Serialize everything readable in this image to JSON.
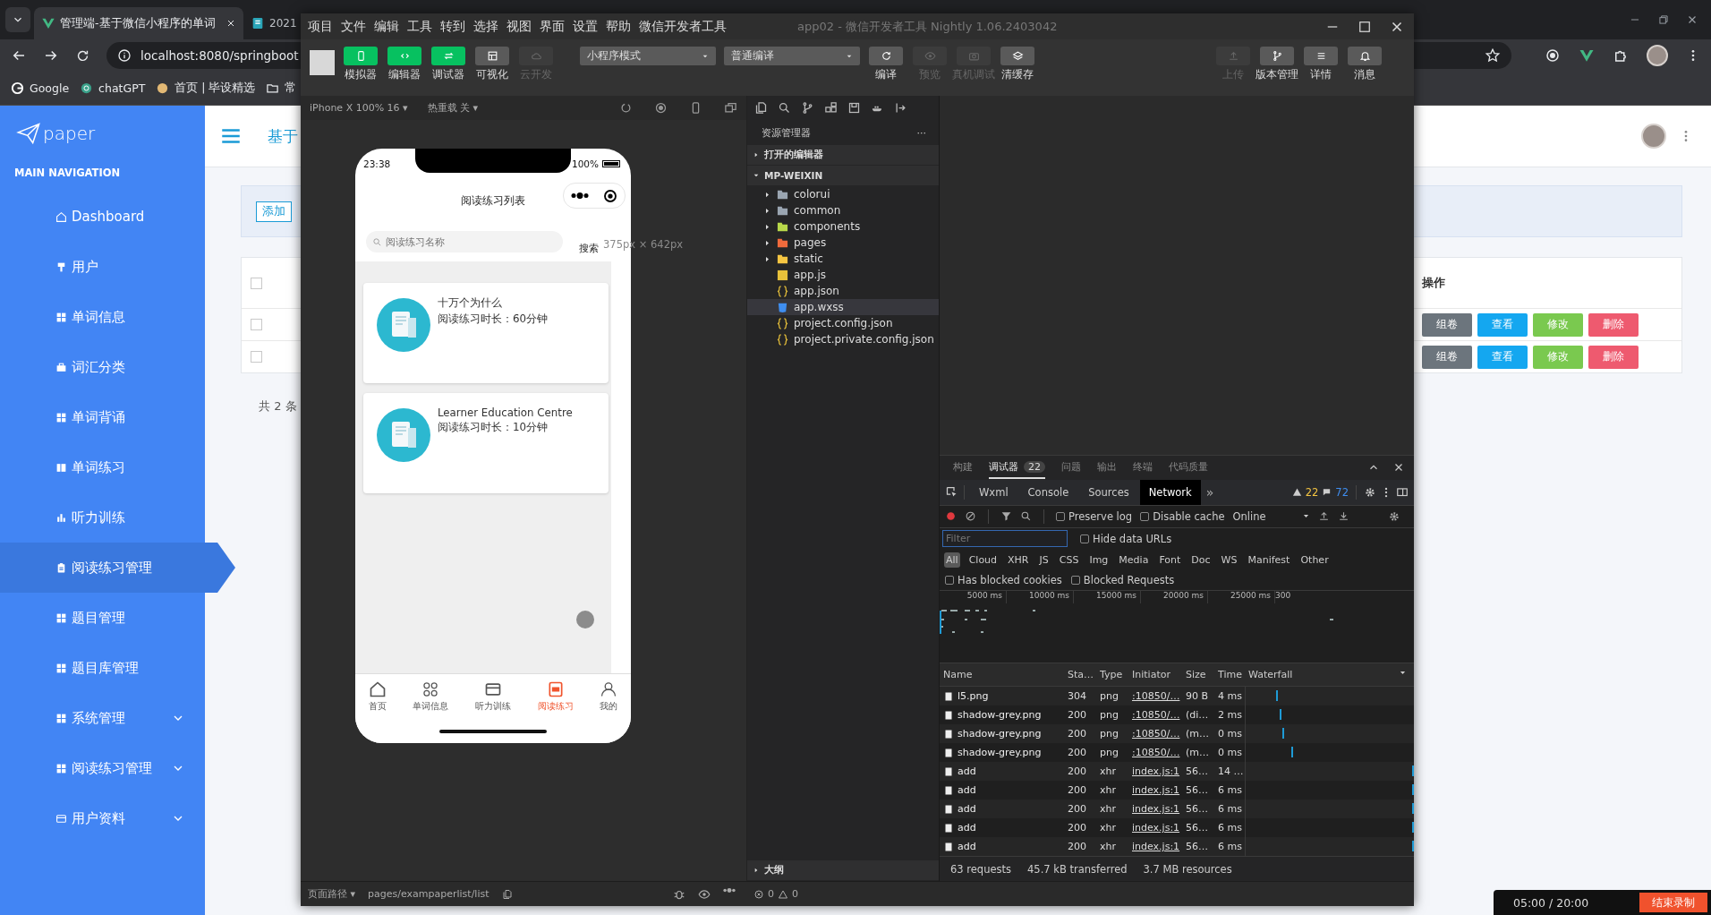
{
  "browser": {
    "tabs": [
      {
        "title": "管理端-基于微信小程序的单词",
        "selected": true
      },
      {
        "title": "2021",
        "selected": false
      }
    ],
    "address": "localhost:8080/springboot",
    "bookmarks": [
      {
        "label": "Google"
      },
      {
        "label": "chatGPT"
      },
      {
        "label": "首页 | 毕设精选"
      },
      {
        "label": "常"
      }
    ]
  },
  "admin": {
    "logo": "paper",
    "nav_heading": "MAIN NAVIGATION",
    "nav": [
      {
        "label": "Dashboard",
        "kind": "link",
        "selected": false
      },
      {
        "label": "用户",
        "kind": "link",
        "selected": false
      },
      {
        "label": "单词信息",
        "kind": "link",
        "selected": false
      },
      {
        "label": "词汇分类",
        "kind": "link",
        "selected": false
      },
      {
        "label": "单词背诵",
        "kind": "link",
        "selected": false
      },
      {
        "label": "单词练习",
        "kind": "link",
        "selected": false
      },
      {
        "label": "听力训练",
        "kind": "link",
        "selected": false
      },
      {
        "label": "阅读练习管理",
        "kind": "link",
        "selected": true
      },
      {
        "label": "题目管理",
        "kind": "link",
        "selected": false
      },
      {
        "label": "题目库管理",
        "kind": "link",
        "selected": false
      },
      {
        "label": "系统管理",
        "kind": "group",
        "selected": false
      },
      {
        "label": "阅读练习管理",
        "kind": "group",
        "selected": false
      },
      {
        "label": "用户资料",
        "kind": "group",
        "selected": false
      }
    ],
    "header_title": "基于",
    "add_button": "添加",
    "table": {
      "header_checked": false,
      "actions_header": "操作",
      "rows": [
        {
          "checked": false,
          "actions": [
            {
              "label": "组卷",
              "color": "#6c757d"
            },
            {
              "label": "查看",
              "color": "#14a7f0"
            },
            {
              "label": "修改",
              "color": "#7ac94f"
            },
            {
              "label": "删除",
              "color": "#ee5a6f"
            }
          ]
        },
        {
          "checked": false,
          "actions": [
            {
              "label": "组卷",
              "color": "#6c757d"
            },
            {
              "label": "查看",
              "color": "#14a7f0"
            },
            {
              "label": "修改",
              "color": "#7ac94f"
            },
            {
              "label": "删除",
              "color": "#ee5a6f"
            }
          ]
        }
      ]
    },
    "total": "共 2 条"
  },
  "devtools": {
    "menu": [
      "项目",
      "文件",
      "编辑",
      "工具",
      "转到",
      "选择",
      "视图",
      "界面",
      "设置",
      "帮助",
      "微信开发者工具"
    ],
    "title": "app02 - 微信开发者工具 Nightly 1.06.2403042",
    "view_buttons": [
      {
        "label": "模拟器",
        "selected": true,
        "disabled": false
      },
      {
        "label": "编辑器",
        "selected": true,
        "disabled": false
      },
      {
        "label": "调试器",
        "selected": true,
        "disabled": false
      },
      {
        "label": "可视化",
        "selected": false,
        "disabled": false
      },
      {
        "label": "云开发",
        "selected": false,
        "disabled": true
      }
    ],
    "modes": [
      "小程序模式",
      "普通编译"
    ],
    "actions": [
      {
        "label": "编译",
        "disabled": false
      },
      {
        "label": "预览",
        "disabled": true
      },
      {
        "label": "真机调试",
        "disabled": true
      },
      {
        "label": "清缓存",
        "disabled": false
      }
    ],
    "right_actions": [
      {
        "label": "上传",
        "disabled": true
      },
      {
        "label": "版本管理",
        "disabled": false
      },
      {
        "label": "详情",
        "disabled": false
      },
      {
        "label": "消息",
        "disabled": false
      }
    ],
    "simulator": {
      "device": "iPhone X 100% 16 ▾",
      "hot_reload": "热重载 关 ▾",
      "size_overlay": "375px × 642px",
      "phone": {
        "time": "23:38",
        "battery": "100%",
        "title": "阅读练习列表",
        "search_placeholder": "阅读练习名称",
        "search_button": "搜索",
        "cards": [
          {
            "title": "十万个为什么",
            "duration": "阅读练习时长：60分钟"
          },
          {
            "title": "Learner Education Centre",
            "duration": "阅读练习时长：10分钟"
          }
        ],
        "tabs": [
          {
            "label": "首页",
            "selected": false
          },
          {
            "label": "单词信息",
            "selected": false
          },
          {
            "label": "听力训练",
            "selected": false
          },
          {
            "label": "阅读练习",
            "selected": true
          },
          {
            "label": "我的",
            "selected": false
          }
        ]
      }
    },
    "explorer": {
      "title": "资源管理器",
      "more": "···",
      "sections": [
        {
          "label": "打开的编辑器",
          "expanded": false
        },
        {
          "label": "MP-WEIXIN",
          "expanded": true,
          "children": [
            {
              "label": "colorui",
              "kind": "folder",
              "color": "#9aa5b1",
              "selected": false
            },
            {
              "label": "common",
              "kind": "folder",
              "color": "#9aa5b1",
              "selected": false
            },
            {
              "label": "components",
              "kind": "folder",
              "color": "#b8d84a",
              "selected": false
            },
            {
              "label": "pages",
              "kind": "folder",
              "color": "#f06a3c",
              "selected": false
            },
            {
              "label": "static",
              "kind": "folder",
              "color": "#f5c542",
              "selected": false
            },
            {
              "label": "app.js",
              "kind": "js",
              "selected": false
            },
            {
              "label": "app.json",
              "kind": "json",
              "selected": false
            },
            {
              "label": "app.wxss",
              "kind": "css",
              "selected": true
            },
            {
              "label": "project.config.json",
              "kind": "json",
              "selected": false
            },
            {
              "label": "project.private.config.json",
              "kind": "json",
              "selected": false
            }
          ]
        }
      ],
      "outline": {
        "label": "大纲",
        "expanded": false
      }
    },
    "debugger": {
      "tabs": [
        {
          "label": "构建",
          "selected": false
        },
        {
          "label": "调试器",
          "badge": "22",
          "selected": true
        },
        {
          "label": "问题",
          "selected": false
        },
        {
          "label": "输出",
          "selected": false
        },
        {
          "label": "终端",
          "selected": false
        },
        {
          "label": "代码质量",
          "selected": false
        }
      ],
      "panels": [
        {
          "label": "Wxml",
          "selected": false
        },
        {
          "label": "Console",
          "selected": false
        },
        {
          "label": "Sources",
          "selected": false
        },
        {
          "label": "Network",
          "selected": true
        }
      ],
      "more": "»",
      "warnings": "22",
      "messages": "72",
      "toggles": [
        {
          "label": "Preserve log",
          "checked": false
        },
        {
          "label": "Disable cache",
          "checked": false
        }
      ],
      "throttle": "Online",
      "filter": {
        "placeholder": "Filter"
      },
      "hide_data_urls": {
        "label": "Hide data URLs",
        "checked": false
      },
      "types": [
        {
          "label": "All",
          "selected": true
        },
        {
          "label": "Cloud",
          "selected": false
        },
        {
          "label": "XHR",
          "selected": false
        },
        {
          "label": "JS",
          "selected": false
        },
        {
          "label": "CSS",
          "selected": false
        },
        {
          "label": "Img",
          "selected": false
        },
        {
          "label": "Media",
          "selected": false
        },
        {
          "label": "Font",
          "selected": false
        },
        {
          "label": "Doc",
          "selected": false
        },
        {
          "label": "WS",
          "selected": false
        },
        {
          "label": "Manifest",
          "selected": false
        },
        {
          "label": "Other",
          "selected": false
        }
      ],
      "blocked": [
        {
          "label": "Has blocked cookies",
          "checked": false
        },
        {
          "label": "Blocked Requests",
          "checked": false
        }
      ],
      "timeline_ticks": [
        "5000 ms",
        "10000 ms",
        "15000 ms",
        "20000 ms",
        "25000 ms",
        "300"
      ],
      "columns": [
        "Name",
        "Sta…",
        "Type",
        "Initiator",
        "Size",
        "Time",
        "Waterfall"
      ],
      "rows": [
        {
          "name": "l5.png",
          "status": "304",
          "type": "png",
          "initiator": ":10850/…",
          "size": "90 B",
          "time": "4 ms"
        },
        {
          "name": "shadow-grey.png",
          "status": "200",
          "type": "png",
          "initiator": ":10850/…",
          "size": "(di…",
          "time": "2 ms"
        },
        {
          "name": "shadow-grey.png",
          "status": "200",
          "type": "png",
          "initiator": ":10850/…",
          "size": "(m…",
          "time": "0 ms"
        },
        {
          "name": "shadow-grey.png",
          "status": "200",
          "type": "png",
          "initiator": ":10850/…",
          "size": "(m…",
          "time": "0 ms"
        },
        {
          "name": "add",
          "status": "200",
          "type": "xhr",
          "initiator": "index.js:1",
          "size": "56…",
          "time": "14 …"
        },
        {
          "name": "add",
          "status": "200",
          "type": "xhr",
          "initiator": "index.js:1",
          "size": "56…",
          "time": "6 ms"
        },
        {
          "name": "add",
          "status": "200",
          "type": "xhr",
          "initiator": "index.js:1",
          "size": "56…",
          "time": "6 ms"
        },
        {
          "name": "add",
          "status": "200",
          "type": "xhr",
          "initiator": "index.js:1",
          "size": "56…",
          "time": "6 ms"
        },
        {
          "name": "add",
          "status": "200",
          "type": "xhr",
          "initiator": "index.js:1",
          "size": "56…",
          "time": "6 ms"
        }
      ],
      "summary": [
        "63 requests",
        "45.7 kB transferred",
        "3.7 MB resources"
      ]
    },
    "status_bar": {
      "path_label": "页面路径 ▾",
      "path": "pages/exampaperlist/list",
      "errors": "0",
      "warnings": "0"
    }
  },
  "recorder": {
    "time": "05:00 / 20:00",
    "stop": "结束录制"
  }
}
